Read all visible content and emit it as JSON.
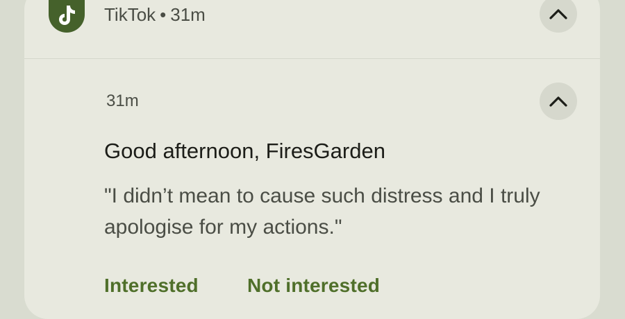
{
  "header": {
    "app_name": "TikTok",
    "separator": "•",
    "time": "31m",
    "app_icon": "tiktok-icon",
    "collapse_icon": "chevron-up-icon"
  },
  "message": {
    "time": "31m",
    "title": "Good afternoon, FiresGarden",
    "body": "\"I didn’t mean to cause such distress and I truly apologise for my actions.\"",
    "collapse_icon": "chevron-up-icon"
  },
  "actions": [
    {
      "label": "Interested"
    },
    {
      "label": "Not interested"
    }
  ],
  "colors": {
    "background": "#d9dcd0",
    "card": "#e8e9df",
    "icon_bg": "#45612b",
    "action_text": "#4f6f2a",
    "button_bg": "#d6d8cd"
  }
}
